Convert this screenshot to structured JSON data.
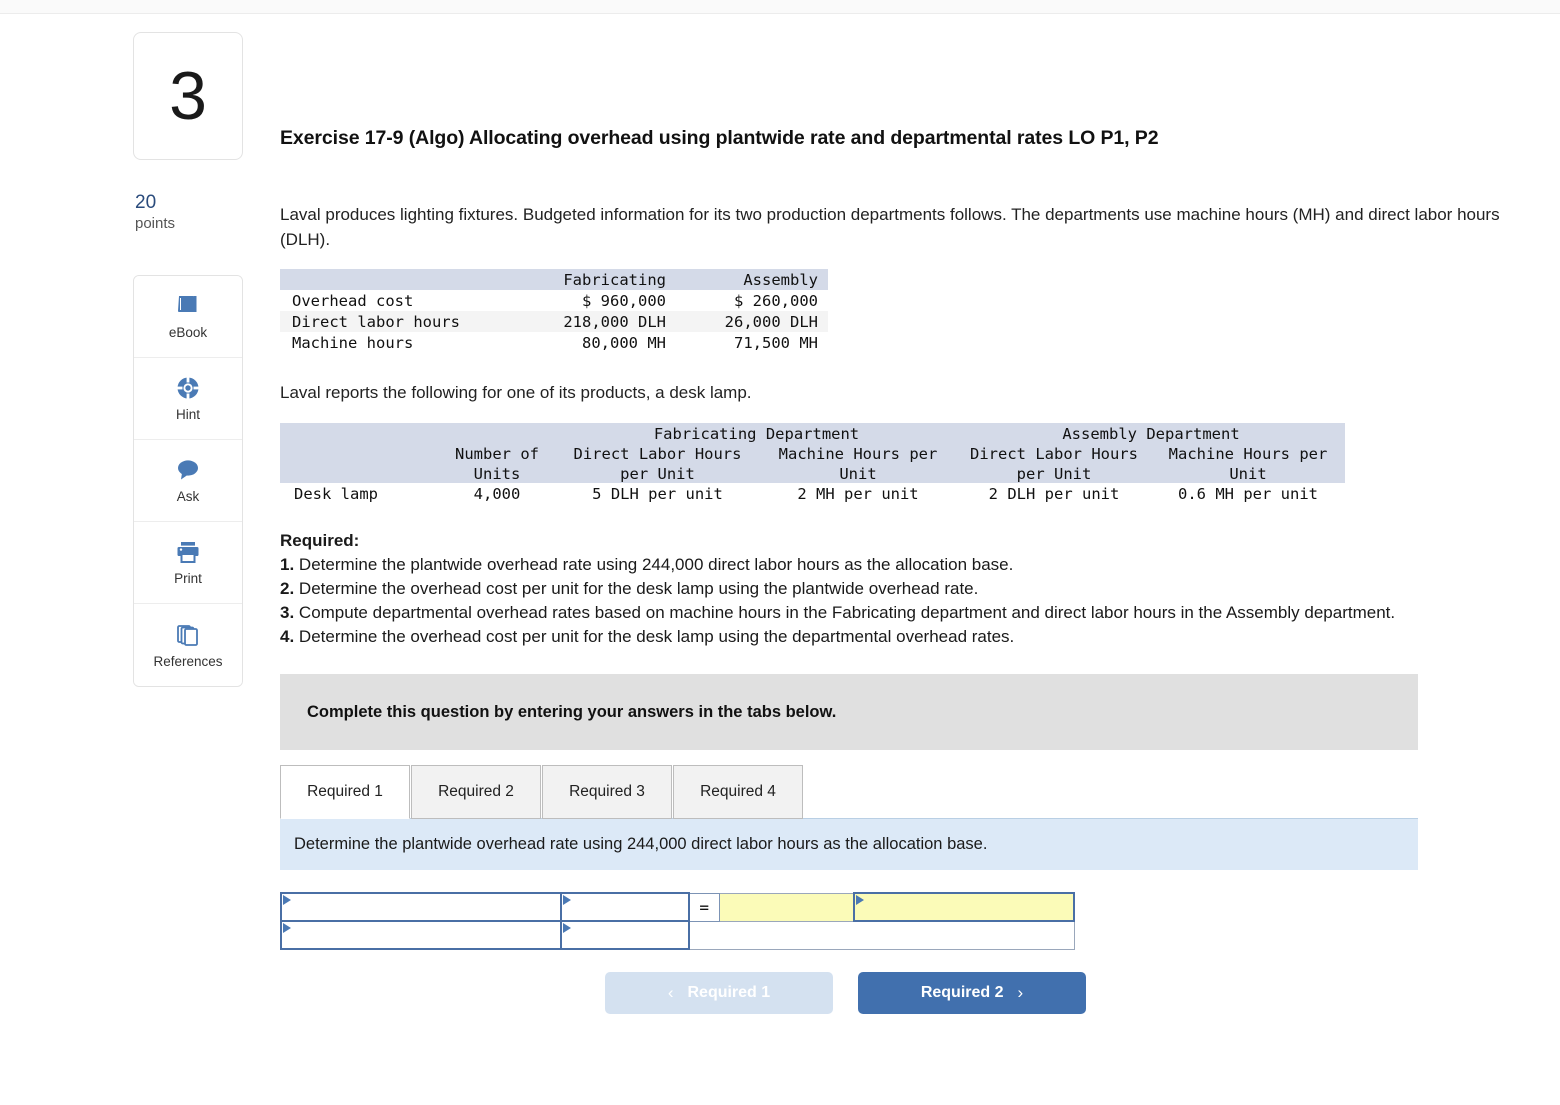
{
  "question": {
    "number": "3",
    "points_value": "20",
    "points_label": "points"
  },
  "header": {
    "title": "Exercise 17-9 (Algo) Allocating overhead using plantwide rate and departmental rates LO P1, P2"
  },
  "body": {
    "intro": "Laval produces lighting fixtures. Budgeted information for its two production departments follows. The departments use machine hours (MH) and direct labor hours (DLH).",
    "subintro": "Laval reports the following for one of its products, a desk lamp."
  },
  "toolbox": [
    {
      "label": "eBook",
      "icon": "book-icon"
    },
    {
      "label": "Hint",
      "icon": "lifebuoy-icon"
    },
    {
      "label": "Ask",
      "icon": "chat-bubble-icon"
    },
    {
      "label": "Print",
      "icon": "printer-icon"
    },
    {
      "label": "References",
      "icon": "copy-pages-icon"
    }
  ],
  "budget_table": {
    "columns": [
      "",
      "Fabricating",
      "Assembly"
    ],
    "rows": [
      {
        "label": "Overhead cost",
        "fabricating": "$ 960,000",
        "assembly": "$ 260,000"
      },
      {
        "label": "Direct labor hours",
        "fabricating": "218,000 DLH",
        "assembly": "26,000 DLH"
      },
      {
        "label": "Machine hours",
        "fabricating": "80,000 MH",
        "assembly": "71,500 MH"
      }
    ]
  },
  "product_table": {
    "group_headers": [
      "",
      "",
      "Fabricating Department",
      "Assembly Department"
    ],
    "fabricating_group": "Fabricating Department",
    "assembly_group": "Assembly Department",
    "columns": [
      {
        "line1": "",
        "line2": ""
      },
      {
        "line1": "Number of",
        "line2": "Units"
      },
      {
        "line1": "Direct Labor Hours",
        "line2": "per Unit"
      },
      {
        "line1": "Machine Hours per",
        "line2": "Unit"
      },
      {
        "line1": "Direct Labor Hours",
        "line2": "per Unit"
      },
      {
        "line1": "Machine Hours per",
        "line2": "Unit"
      }
    ],
    "row": {
      "label": "Desk lamp",
      "units": "4,000",
      "fab_dlh_per_unit": "5 DLH per unit",
      "fab_mh_per_unit": "2 MH per unit",
      "asm_dlh_per_unit": "2 DLH per unit",
      "asm_mh_per_unit": "0.6 MH per unit"
    }
  },
  "required": {
    "heading": "Required:",
    "items": [
      {
        "num": "1.",
        "text": " Determine the plantwide overhead rate using 244,000 direct labor hours as the allocation base."
      },
      {
        "num": "2.",
        "text": " Determine the overhead cost per unit for the desk lamp using the plantwide overhead rate."
      },
      {
        "num": "3.",
        "text": " Compute departmental overhead rates based on machine hours in the Fabricating department and direct labor hours in the Assembly department."
      },
      {
        "num": "4.",
        "text": " Determine the overhead cost per unit for the desk lamp using the departmental overhead rates."
      }
    ]
  },
  "answer_panel": {
    "banner": "Complete this question by entering your answers in the tabs below.",
    "tabs": [
      {
        "label": "Required 1",
        "active": true
      },
      {
        "label": "Required 2",
        "active": false
      },
      {
        "label": "Required 3",
        "active": false
      },
      {
        "label": "Required 4",
        "active": false
      }
    ],
    "tab_instruction": "Determine the plantwide overhead rate using 244,000 direct labor hours as the allocation base.",
    "grid": {
      "equals_symbol": "=",
      "row1": {
        "c1": "",
        "c2": "",
        "c3": "",
        "c4": ""
      },
      "row2": {
        "c1": "",
        "c2": ""
      }
    }
  },
  "navigation": {
    "prev_label": "Required 1",
    "prev_chevron": "‹",
    "next_label": "Required 2",
    "next_chevron": "›"
  },
  "colors": {
    "accent_blue": "#4170ae",
    "table_header": "#d4dae8",
    "tab_panel": "#dce9f7",
    "answer_yellow": "#fbfbb8",
    "banner_gray": "#e0e0e0",
    "points_blue": "#2a4b7c"
  }
}
